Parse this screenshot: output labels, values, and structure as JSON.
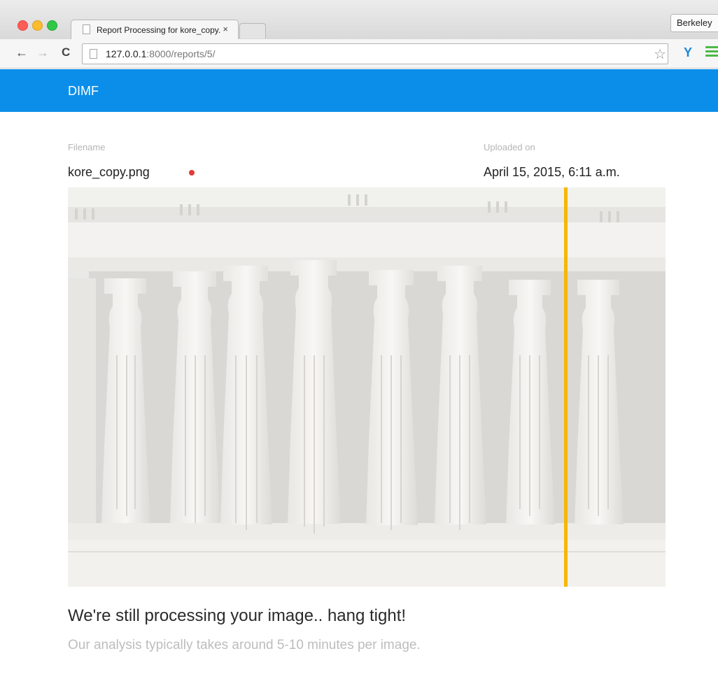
{
  "browser": {
    "tab_title": "Report Processing for kore_copy.png",
    "tab_close": "×",
    "profile_name": "Berkeley",
    "url_host": "127.0.0.1",
    "url_path": ":8000/reports/5/",
    "back_glyph": "←",
    "forward_glyph": "→",
    "reload_glyph": "C",
    "star_glyph": "☆",
    "extension_glyph": "Y"
  },
  "app": {
    "brand": "DIMF"
  },
  "report": {
    "filename_label": "Filename",
    "filename": "kore_copy.png",
    "uploaded_label": "Uploaded on",
    "uploaded_on": "April 15, 2015, 6:11 a.m.",
    "status_color": "#e53935",
    "processing_progress_fraction": 0.83
  },
  "message": {
    "title": "We're still processing your image.. hang tight!",
    "subtitle": "Our analysis typically takes around 5-10 minutes per image."
  },
  "colors": {
    "header_bg": "#0b8ee9",
    "scan_line": "#f5b800"
  }
}
